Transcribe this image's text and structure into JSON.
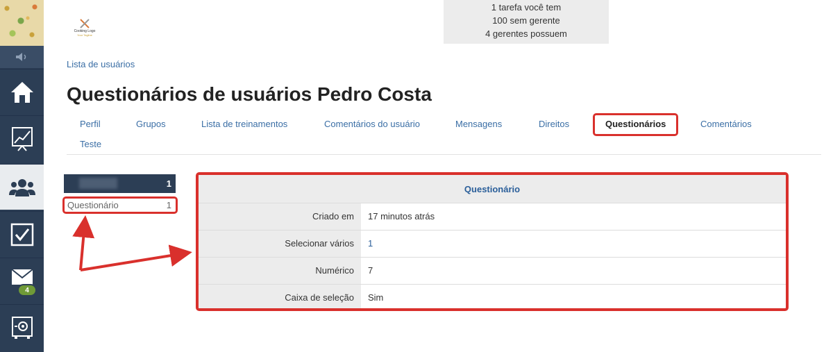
{
  "brand": {
    "name": "Cooking Logo",
    "tagline": "Your Tagline"
  },
  "notice": {
    "line1": "1 tarefa você tem",
    "line2": "100 sem gerente",
    "line3": "4 gerentes possuem"
  },
  "sidebar": {
    "items": [
      {
        "icon": "home-icon"
      },
      {
        "icon": "chart-icon"
      },
      {
        "icon": "users-icon",
        "active": true
      },
      {
        "icon": "checkbox-icon"
      },
      {
        "icon": "mail-icon",
        "badge": "4"
      },
      {
        "icon": "safe-icon"
      }
    ]
  },
  "breadcrumb": "Lista de usuários",
  "page_title": "Questionários de usuários Pedro Costa",
  "tabs": [
    {
      "label": "Perfil"
    },
    {
      "label": "Grupos"
    },
    {
      "label": "Lista de treinamentos"
    },
    {
      "label": "Comentários do usuário"
    },
    {
      "label": "Mensagens"
    },
    {
      "label": "Direitos"
    },
    {
      "label": "Questionários",
      "active": true
    },
    {
      "label": "Comentários"
    },
    {
      "label": "Teste"
    }
  ],
  "mini_list": {
    "header_count": "1",
    "item_label": "Questionário",
    "item_count": "1"
  },
  "questionnaire": {
    "title": "Questionário",
    "rows": [
      {
        "label": "Criado em",
        "value": "17 minutos atrás"
      },
      {
        "label": "Selecionar vários",
        "value": "1"
      },
      {
        "label": "Numérico",
        "value": "7"
      },
      {
        "label": "Caixa de seleção",
        "value": "Sim"
      }
    ]
  },
  "colors": {
    "sidebar_bg": "#2c3e55",
    "link": "#3a6ea5",
    "highlight_red": "#d9302c",
    "badge_green": "#6f9a37"
  }
}
